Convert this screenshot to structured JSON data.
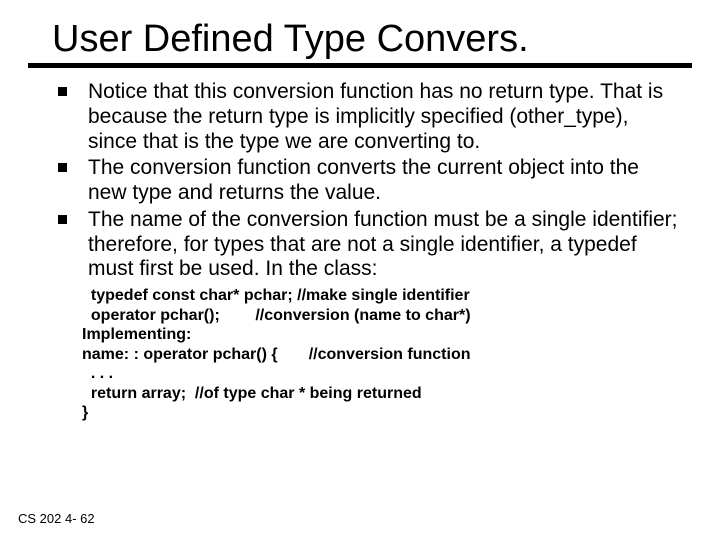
{
  "title": "User Defined Type Convers.",
  "bullets": [
    "Notice that this conversion function has no return type. That is because the return type is implicitly specified (other_type), since that is the type we are converting to.",
    "The conversion function converts the current object into the new type and returns the value.",
    "The name of the conversion function must be a single identifier; therefore, for types that are not a single identifier, a typedef must first be used. In the class:"
  ],
  "code": "  typedef const char* pchar; //make single identifier\n  operator pchar();        //conversion (name to char*)\nImplementing:\nname: : operator pchar() {       //conversion function\n  . . .\n  return array;  //of type char * being returned\n}",
  "footer": "CS 202   4- 62"
}
